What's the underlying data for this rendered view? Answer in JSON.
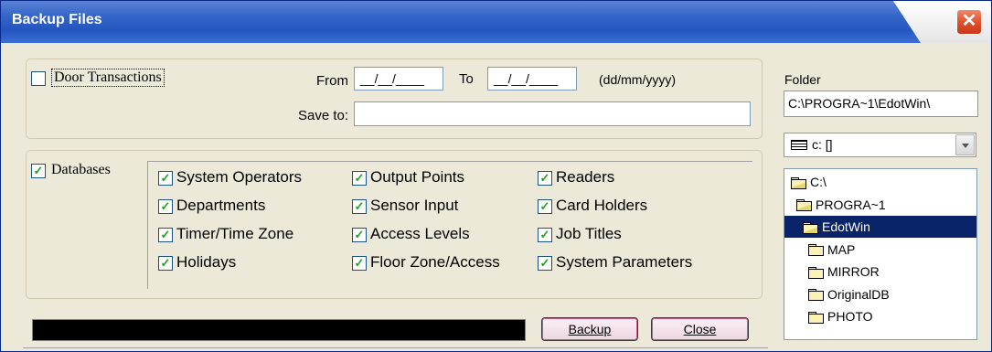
{
  "window": {
    "title": "Backup Files",
    "close_glyph": "✕"
  },
  "door": {
    "label": "Door Transactions",
    "checked": false,
    "from_label": "From",
    "from_value": "__/__/____",
    "to_label": "To",
    "to_value": "__/__/____",
    "date_format": "(dd/mm/yyyy)",
    "save_to_label": "Save to:",
    "save_to_value": ""
  },
  "databases": {
    "label": "Databases",
    "checked": true,
    "items": [
      {
        "label": "System Operators",
        "checked": true
      },
      {
        "label": "Departments",
        "checked": true
      },
      {
        "label": "Timer/Time Zone",
        "checked": true
      },
      {
        "label": "Holidays",
        "checked": true
      },
      {
        "label": "Output Points",
        "checked": true
      },
      {
        "label": "Sensor Input",
        "checked": true
      },
      {
        "label": "Access Levels",
        "checked": true
      },
      {
        "label": "Floor Zone/Access",
        "checked": true
      },
      {
        "label": "Readers",
        "checked": true
      },
      {
        "label": "Card Holders",
        "checked": true
      },
      {
        "label": "Job Titles",
        "checked": true
      },
      {
        "label": "System Parameters",
        "checked": true
      }
    ]
  },
  "progress": {
    "value": 0
  },
  "buttons": {
    "backup": "Backup",
    "close": "Close"
  },
  "folder": {
    "label": "Folder",
    "path": "C:\\PROGRA~1\\EdotWin\\",
    "drive": "c: []",
    "tree": [
      {
        "label": "C:\\",
        "open": true,
        "selected": false
      },
      {
        "label": "PROGRA~1",
        "open": true,
        "selected": false
      },
      {
        "label": "EdotWin",
        "open": true,
        "selected": true
      },
      {
        "label": "MAP",
        "open": false,
        "selected": false
      },
      {
        "label": "MIRROR",
        "open": false,
        "selected": false
      },
      {
        "label": "OriginalDB",
        "open": false,
        "selected": false
      },
      {
        "label": "PHOTO",
        "open": false,
        "selected": false
      }
    ]
  },
  "colors": {
    "titlebar": "#2456c0",
    "selection": "#0a246a",
    "close_button": "#e2512e"
  }
}
